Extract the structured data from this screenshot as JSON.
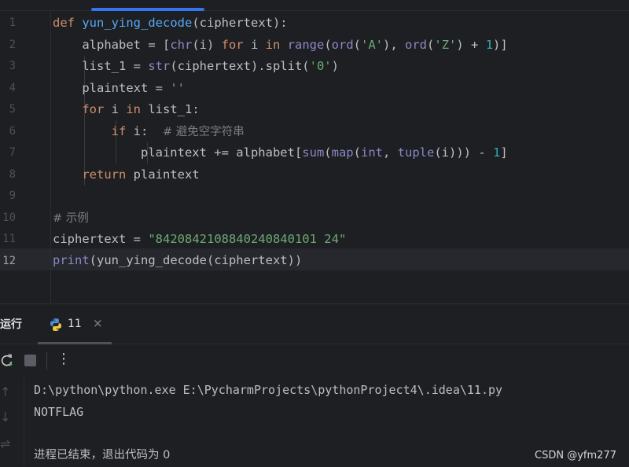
{
  "editor": {
    "line_numbers": [
      "1",
      "2",
      "3",
      "4",
      "5",
      "6",
      "7",
      "8",
      "9",
      "10",
      "11",
      "12"
    ],
    "active_line": "12",
    "code": {
      "l1": {
        "kw": "def",
        "fn": "yun_ying_decode",
        "rest": "(ciphertext):"
      },
      "l2": {
        "a": "alphabet = [",
        "chr": "chr",
        "b": "(i) ",
        "for": "for",
        "c": " i ",
        "in": "in",
        "d": " ",
        "range": "range",
        "e": "(",
        "ord1": "ord",
        "f": "(",
        "sA": "'A'",
        "g": "), ",
        "ord2": "ord",
        "h": "(",
        "sZ": "'Z'",
        "i": ") + ",
        "n1": "1",
        "j": ")]"
      },
      "l3": {
        "a": "list_1 = ",
        "str": "str",
        "b": "(ciphertext).split(",
        "s0": "'0'",
        "c": ")"
      },
      "l4": {
        "a": "plaintext = ",
        "s": "''"
      },
      "l5": {
        "for": "for",
        "a": " i ",
        "in": "in",
        "b": " list_1:"
      },
      "l6": {
        "if": "if",
        "a": " i:  ",
        "comment": "# 避免空字符串"
      },
      "l7": {
        "a": "plaintext += alphabet[",
        "sum": "sum",
        "b": "(",
        "map": "map",
        "c": "(",
        "int": "int",
        "d": ", ",
        "tuple": "tuple",
        "e": "(i))) - ",
        "n1": "1",
        "f": "]"
      },
      "l8": {
        "kw": "return",
        "rest": " plaintext"
      },
      "l10": {
        "comment": "# 示例"
      },
      "l11": {
        "a": "ciphertext = ",
        "s": "\"8420842108840240840101 24\""
      },
      "l12": {
        "print": "print",
        "rest": "(yun_ying_decode(ciphertext))"
      }
    }
  },
  "run_panel": {
    "title": "运行",
    "tab_label": "11",
    "tab_close": "×",
    "console_lines": [
      "D:\\python\\python.exe E:\\PycharmProjects\\pythonProject4\\.idea\\11.py",
      "NOTFLAG",
      "",
      "进程已结束，退出代码为 0"
    ]
  },
  "watermark": "CSDN @yfm277",
  "colors": {
    "background": "#1e1f22",
    "keyword": "#cf8e6d",
    "function": "#56a8f5",
    "builtin": "#8888c6",
    "string": "#6aab73",
    "number": "#2aacb8",
    "comment": "#7a7e85",
    "accent": "#3574f0"
  }
}
